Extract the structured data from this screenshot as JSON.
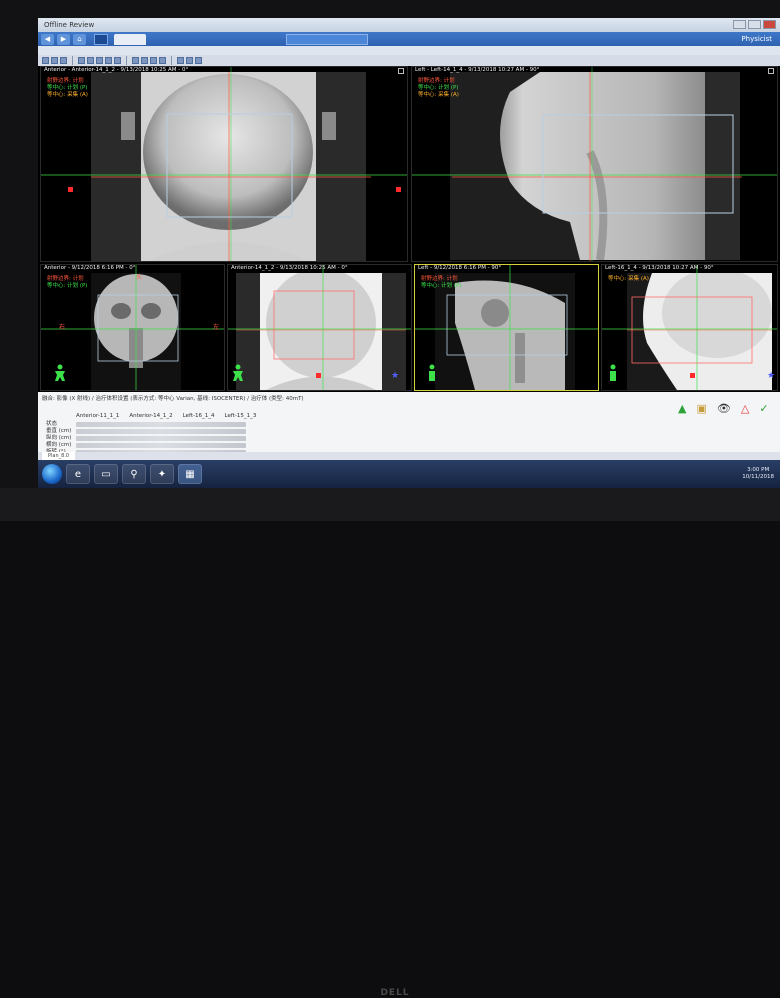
{
  "window": {
    "title": "Offline Review"
  },
  "menubar": {
    "combo": "",
    "patient_tab": "",
    "second_tab": "",
    "user": "Physicist"
  },
  "viewports": [
    {
      "title": "Anterior - Anterior-14_1_2 - 9/13/2018 10:25 AM - 0°",
      "legend": [
        "射野边界: 计划",
        "等中心: 计划 (P)",
        "等中心: 采集 (A)"
      ]
    },
    {
      "title": "Left - Left-14_1_4 - 9/13/2018 10:27 AM - 90°",
      "legend": [
        "射野边界: 计划",
        "等中心: 计划 (P)",
        "等中心: 采集 (A)"
      ]
    },
    {
      "title": "Anterior - 9/12/2018 6:16 PM - 0°",
      "legend": [
        "射野边界: 计划",
        "等中心: 计划 (P)"
      ]
    },
    {
      "title": "Anterior-14_1_2 - 9/13/2018 10:25 AM - 0°",
      "legend": []
    },
    {
      "title": "Left - 9/12/2018 6:16 PM - 90°",
      "legend": [
        "射野边界: 计划",
        "等中心: 计划 (P)"
      ]
    },
    {
      "title": "Left-16_1_4 - 9/13/2018 10:27 AM - 90°",
      "legend": [
        "等中心: 采集 (A)"
      ]
    }
  ],
  "bottom": {
    "header": "融合: 影像 (X 射线) / 治疗体积设置 (表示方式: 等中心 Varian, 基线: ISOCENTER) / 治疗体 (类型: 40mT)",
    "tabs": [
      "Anterior-11_1_1",
      "Anterior-14_1_2",
      "Left-16_1_4",
      "Left-15_1_3"
    ],
    "rows": [
      "状态",
      "垂直 (cm)",
      "纵向 (cm)",
      "横向 (cm)",
      "旋转 (°)"
    ],
    "status_tabs": [
      "Plan_8.0",
      "",
      ""
    ]
  },
  "taskbar": {
    "time": "3:00 PM",
    "date": "10/11/2018"
  },
  "colors": {
    "field_border": "#b9cde0",
    "planned_isocenter": "#3de24a",
    "acquired_isocenter": "#ff5a3c",
    "selected_frame": "#d6d13a"
  }
}
